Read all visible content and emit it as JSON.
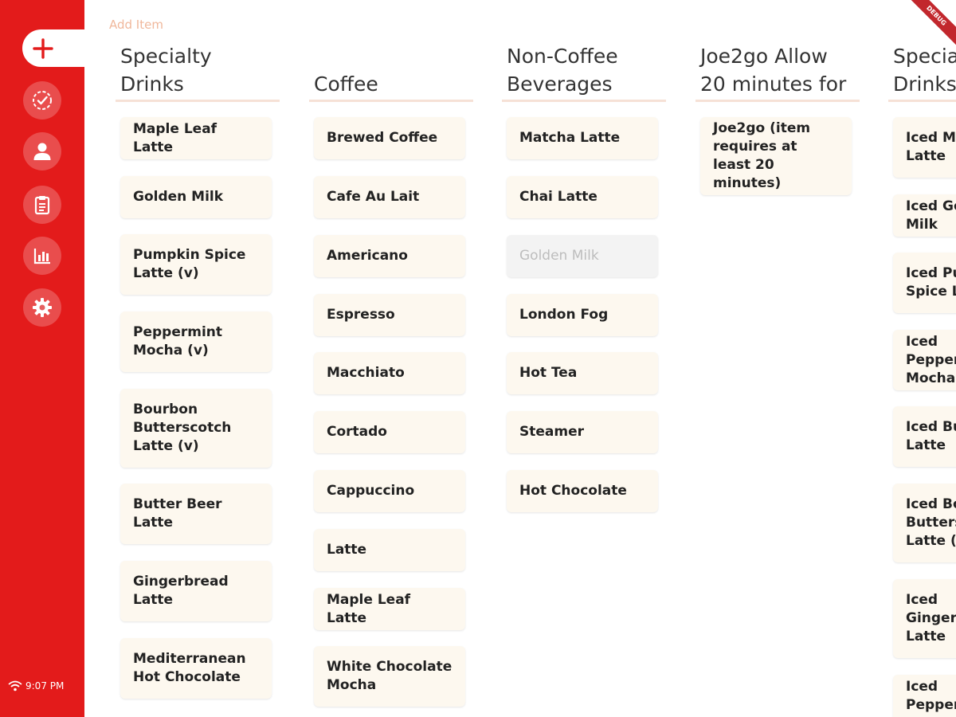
{
  "toolbar": {
    "add_item_label": "Add Item"
  },
  "status": {
    "time": "9:07 PM"
  },
  "banner": {
    "label": "DEBUG"
  },
  "colors": {
    "sidebar": "#e31b1b",
    "card": "#fdf8ef",
    "accent_text": "#f0b89c"
  },
  "nav": {
    "items": [
      {
        "icon": "add-icon"
      },
      {
        "icon": "check-circle-icon"
      },
      {
        "icon": "person-icon"
      },
      {
        "icon": "clipboard-icon"
      },
      {
        "icon": "bar-chart-icon"
      },
      {
        "icon": "gear-icon"
      }
    ]
  },
  "columns": [
    {
      "title_lines": [
        "Specialty",
        "Drinks"
      ],
      "items": [
        {
          "label": "Maple Leaf Latte"
        },
        {
          "label": "Golden Milk"
        },
        {
          "label": "Pumpkin Spice Latte (v)"
        },
        {
          "label": "Peppermint Mocha (v)"
        },
        {
          "label": "Bourbon Butterscotch Latte (v)"
        },
        {
          "label": "Butter Beer Latte"
        },
        {
          "label": "Gingerbread Latte"
        },
        {
          "label": "Mediterranean Hot Chocolate"
        }
      ]
    },
    {
      "title_lines": [
        "Coffee"
      ],
      "items": [
        {
          "label": "Brewed Coffee"
        },
        {
          "label": "Cafe Au Lait"
        },
        {
          "label": "Americano"
        },
        {
          "label": "Espresso"
        },
        {
          "label": "Macchiato"
        },
        {
          "label": "Cortado"
        },
        {
          "label": "Cappuccino"
        },
        {
          "label": "Latte"
        },
        {
          "label": "Maple Leaf Latte"
        },
        {
          "label": "White Chocolate Mocha"
        }
      ]
    },
    {
      "title_lines": [
        "Non-Coffee",
        "Beverages"
      ],
      "items": [
        {
          "label": "Matcha Latte"
        },
        {
          "label": "Chai Latte"
        },
        {
          "label": "Golden Milk",
          "disabled": true
        },
        {
          "label": "London Fog"
        },
        {
          "label": "Hot Tea"
        },
        {
          "label": "Steamer"
        },
        {
          "label": "Hot Chocolate"
        }
      ]
    },
    {
      "title_lines": [
        "Joe2go Allow",
        "20 minutes for"
      ],
      "items": [
        {
          "label": "Joe2go (item requires at least 20 minutes)"
        }
      ]
    },
    {
      "title_lines": [
        "Specialty",
        "Drinks"
      ],
      "items": [
        {
          "label": "Iced Maple Leaf Latte"
        },
        {
          "label": "Iced Golden Milk"
        },
        {
          "label": "Iced Pumpkin Spice Latte"
        },
        {
          "label": "Iced Peppermint Mocha"
        },
        {
          "label": "Iced Butter Beer Latte"
        },
        {
          "label": "Iced Bourbon Butterscotch Latte (v)"
        },
        {
          "label": "Iced Gingerbread Latte"
        },
        {
          "label": "Iced Peppermint Butter"
        }
      ]
    }
  ]
}
